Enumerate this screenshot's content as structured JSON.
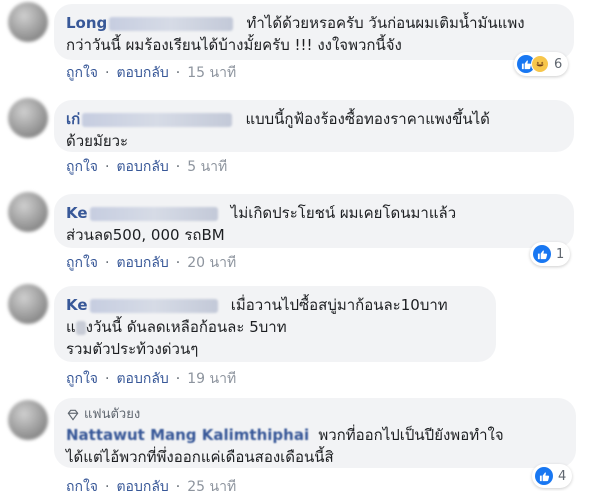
{
  "comments": [
    {
      "author": "Long",
      "text_line1": "ทำได้ด้วยหรอครับ วันก่อนผมเติมน้ำมันแพง",
      "text_line2": "กว่าวันนี้ ผมร้องเรียนได้บ้างมั้ยครับ !!! งงใจพวกนี้จัง",
      "like_label": "ถูกใจ",
      "reply_label": "ตอบกลับ",
      "time": "15 นาที",
      "reaction_count": "6",
      "reactions": [
        "like-icon",
        "haha-icon"
      ]
    },
    {
      "author": "เก่",
      "text_line1": "แบบนี้กูฟ้องร้องซื้อทองราคาแพงขึ้นได้",
      "text_line2": "ด้วยมัยวะ",
      "like_label": "ถูกใจ",
      "reply_label": "ตอบกลับ",
      "time": "5 นาที"
    },
    {
      "author": "Ke",
      "text_line1": "ไม่เกิดประโยชน์ ผมเคยโดนมาแล้ว",
      "text_line2": "ส่วนลด500, 000 รถBM",
      "like_label": "ถูกใจ",
      "reply_label": "ตอบกลับ",
      "time": "20 นาที",
      "reaction_count": "1",
      "reactions": [
        "like-icon"
      ]
    },
    {
      "author": "Ke",
      "text_line1": "เมื่อวานไปซื้อสบู่มาก้อนละ10บาท",
      "text_line2a": "แ",
      "text_line2b": "งวันนี้ ดันลดเหลือก้อนละ 5บาท",
      "text_line3": "รวมตัวประท้วงด่วนๆ",
      "like_label": "ถูกใจ",
      "reply_label": "ตอบกลับ",
      "time": "19 นาที"
    },
    {
      "badge": "แฟนตัวยง",
      "author": "Nattawut Mang Kalimthiphai",
      "text_line1": "พวกที่ออกไปเป็นปียังพอทำใจ",
      "text_line2": "ได้แต่ไอ้พวกที่พึ่งออกแค่เดือนสองเดือนนี้สิ",
      "like_label": "ถูกใจ",
      "reply_label": "ตอบกลับ",
      "time": "25 นาที",
      "reaction_count": "4",
      "reactions": [
        "like-icon"
      ]
    }
  ],
  "colors": {
    "bubble": "#f2f3f5",
    "author": "#385898",
    "like_blue": "#1877f2",
    "meta_gray": "#606770"
  }
}
